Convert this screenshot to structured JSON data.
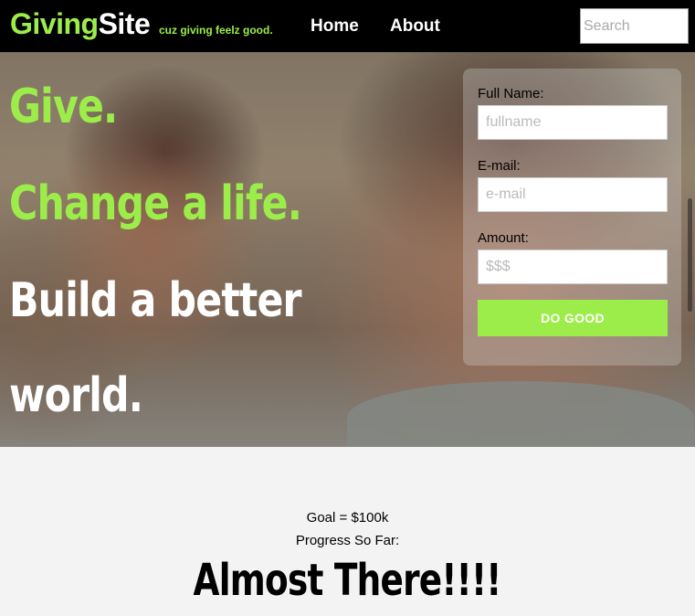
{
  "nav": {
    "brand_part1": "Giving",
    "brand_part2": "Site",
    "tagline": "cuz giving feelz good.",
    "links": [
      "Home",
      "About"
    ],
    "search_placeholder": "Search"
  },
  "hero": {
    "lines": [
      "Give.",
      "Change a life.",
      "Build a better",
      "world."
    ]
  },
  "donate_form": {
    "fields": [
      {
        "label": "Full Name:",
        "placeholder": "fullname"
      },
      {
        "label": "E-mail:",
        "placeholder": "e-mail"
      },
      {
        "label": "Amount:",
        "placeholder": "$$$"
      }
    ],
    "submit_label": "DO GOOD"
  },
  "progress": {
    "goal": "Goal = $100k",
    "label": "Progress So Far:",
    "status": "Almost There!!!!"
  },
  "colors": {
    "accent": "#9ced4a",
    "nav_bg": "#000000",
    "section_bg": "#f3f3f3"
  }
}
